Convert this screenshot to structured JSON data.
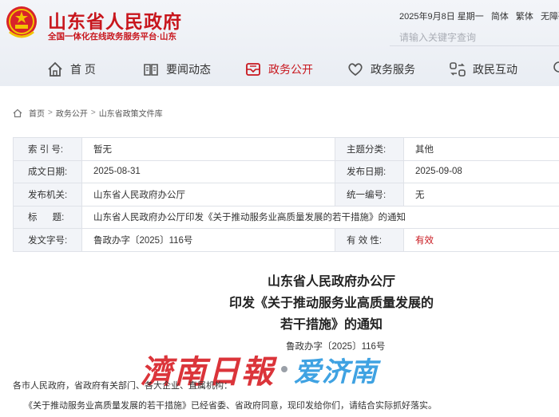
{
  "site": {
    "title": "山东省人民政府",
    "subtitle": "全国一体化在线政务服务平台·山东"
  },
  "top_links": {
    "date": "2025年9月8日 星期一",
    "simplified": "简体",
    "traditional": "繁体",
    "accessibility": "无障碍"
  },
  "search": {
    "placeholder": "请输入关键字查询"
  },
  "nav": {
    "items": [
      {
        "label": "首  页",
        "icon": "home-icon"
      },
      {
        "label": "要闻动态",
        "icon": "book-icon"
      },
      {
        "label": "政务公开",
        "icon": "mailbox-icon"
      },
      {
        "label": "政务服务",
        "icon": "heart-hands-icon"
      },
      {
        "label": "政民互动",
        "icon": "people-exchange-icon"
      }
    ],
    "active_index": 2
  },
  "breadcrumb": [
    "首页",
    "政务公开",
    "山东省政策文件库"
  ],
  "info_table": {
    "index_label": "索 引 号:",
    "index_value": "暂无",
    "category_label": "主题分类:",
    "category_value": "其他",
    "created_label": "成文日期:",
    "created_value": "2025-08-31",
    "published_label": "发布日期:",
    "published_value": "2025-09-08",
    "issuer_label": "发布机关:",
    "issuer_value": "山东省人民政府办公厅",
    "unified_no_label": "统一编号:",
    "unified_no_value": "无",
    "title_label": "标      题:",
    "title_value": "山东省人民政府办公厅印发《关于推动服务业高质量发展的若干措施》的通知",
    "doc_no_label": "发文字号:",
    "doc_no_value": "鲁政办字〔2025〕116号",
    "validity_label": "有 效 性:",
    "validity_value": "有效"
  },
  "document": {
    "title_line1": "山东省人民政府办公厅",
    "title_line2": "印发《关于推动服务业高质量发展的",
    "title_line3": "若干措施》的通知",
    "doc_number": "鲁政办字〔2025〕116号",
    "recipients": "各市人民政府，省政府有关部门、各大企业、直属机构：",
    "body_first_line": "《关于推动服务业高质量发展的若干措施》已经省委、省政府同意，现印发给你们，请结合实际抓好落实。"
  },
  "watermark": {
    "part1": "濟南日報",
    "part2": "爱济南"
  },
  "colors": {
    "brand_red": "#c8161d",
    "watermark_blue": "#2f9be0",
    "header_bg": "#eef1f6"
  }
}
